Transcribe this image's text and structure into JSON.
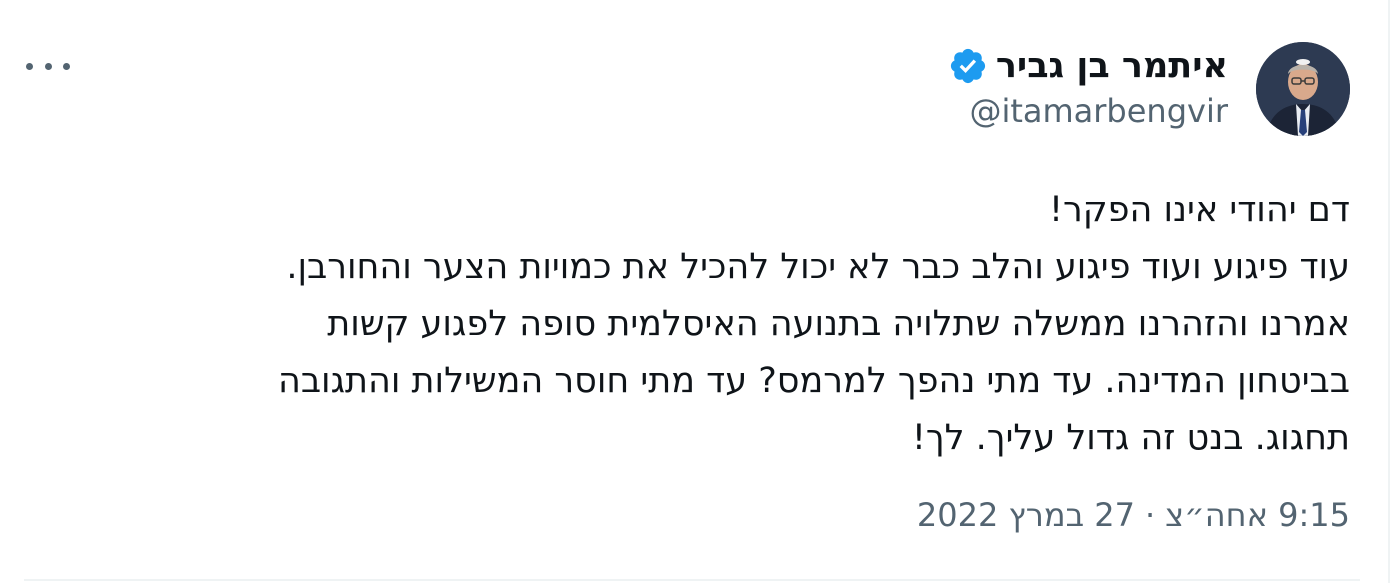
{
  "author": {
    "display_name": "איתמר בן גביר",
    "handle": "@itamarbengvir",
    "verified": true,
    "avatar_icon": "profile-photo-icon"
  },
  "menu": {
    "more_icon": "more-horizontal-icon"
  },
  "tweet": {
    "lines": [
      "דם יהודי אינו הפקר!",
      "עוד פיגוע ועוד פיגוע והלב כבר לא יכול להכיל את כמויות הצער והחורבן.",
      "אמרנו והזהרנו ממשלה שתלויה בתנועה האיסלמית סופה לפגוע קשות",
      "בביטחון המדינה. עד מתי נהפך למרמס? עד מתי חוסר המשילות והתגובה",
      "תחגוג. בנט זה גדול עליך. לך!"
    ]
  },
  "meta": {
    "time": "9:15 אחה״צ",
    "separator": "·",
    "date": "27 במרץ 2022"
  },
  "colors": {
    "text": "#0f1419",
    "secondary": "#536471",
    "verified": "#1d9bf0",
    "border": "#eff3f4"
  }
}
